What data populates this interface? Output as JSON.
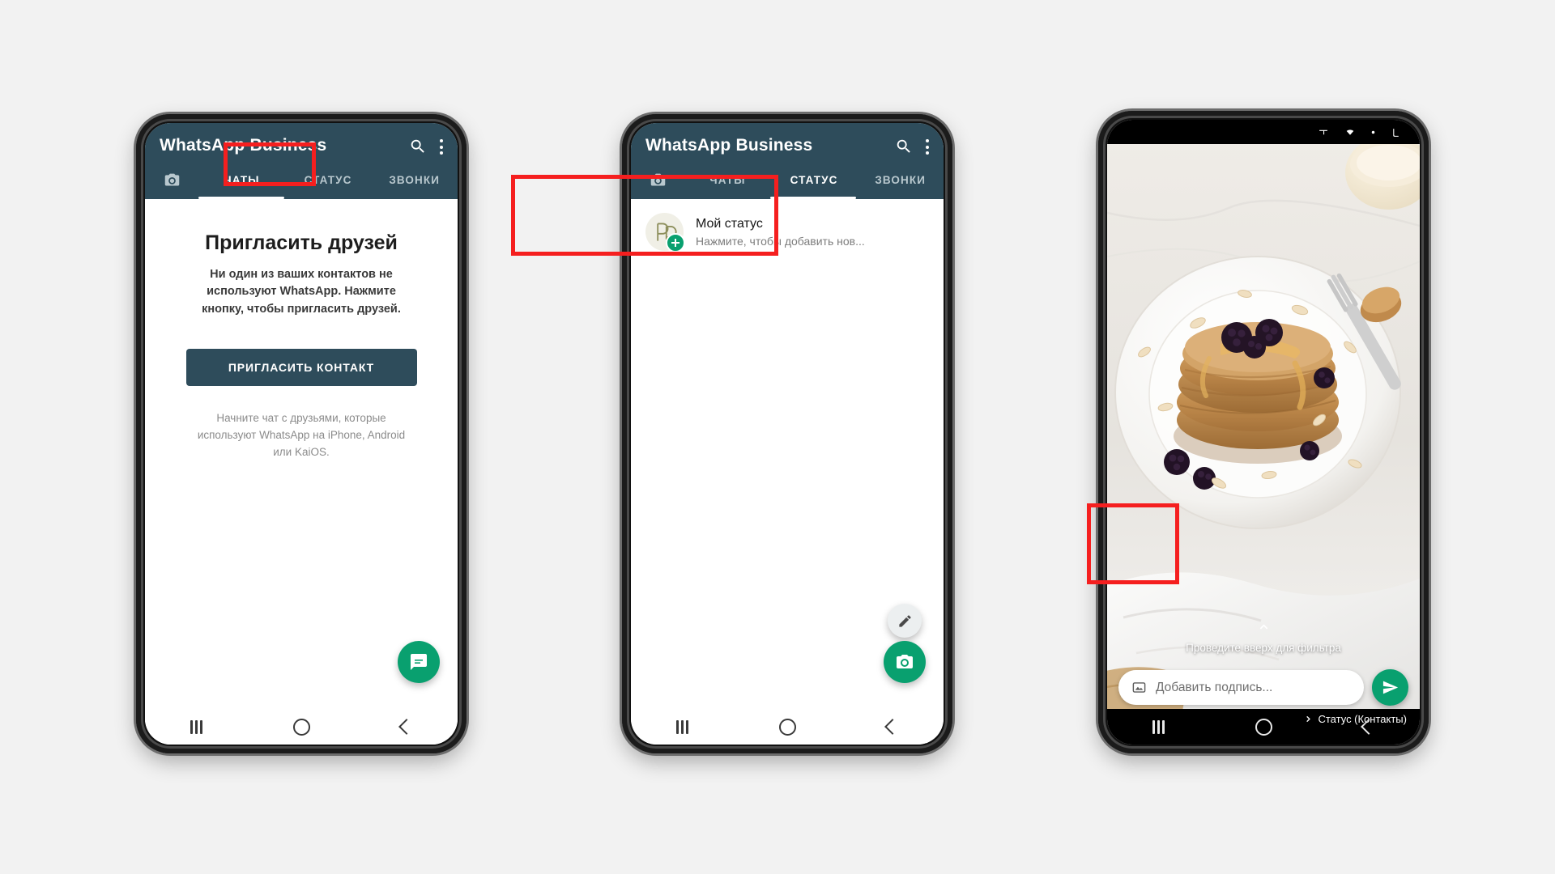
{
  "app": {
    "title": "WhatsApp Business",
    "accent_green": "#09a06f",
    "header_color": "#2e4c5b",
    "annotation_color": "#f51f1f"
  },
  "tabs": [
    {
      "label": "",
      "icon": "camera-icon"
    },
    {
      "label": "ЧАТЫ"
    },
    {
      "label": "СТАТУС"
    },
    {
      "label": "ЗВОНКИ"
    }
  ],
  "phone1": {
    "active_tab": "ЧАТЫ",
    "heading": "Пригласить друзей",
    "description": "Ни один из ваших контактов не используют WhatsApp. Нажмите кнопку, чтобы пригласить друзей.",
    "invite_button": "ПРИГЛАСИТЬ КОНТАКТ",
    "footer": "Начните чат с друзьями, которые используют WhatsApp на iPhone, Android или KaiOS.",
    "fab_icon": "new-chat-icon"
  },
  "phone2": {
    "active_tab": "СТАТУС",
    "my_status_title": "Мой статус",
    "my_status_subtitle": "Нажмите, чтобы добавить нов...",
    "avatar_icon": "business-logo-avatar",
    "badge_icon": "plus-badge-icon",
    "fab_edit_icon": "pencil-icon",
    "fab_camera_icon": "camera-icon"
  },
  "phone3": {
    "filter_hint": "Проведите вверх для фильтра",
    "caption_placeholder": "Добавить подпись...",
    "caption_value": "",
    "gallery_icon": "image-icon",
    "send_icon": "send-icon",
    "recipient": "Статус (Контакты)",
    "recipient_chevron": "chevron-right-icon",
    "photo_alt": "pancakes-with-blackberries-photo"
  },
  "navbar": {
    "recent_label": "recent-apps-button",
    "home_label": "home-button",
    "back_label": "back-button"
  }
}
